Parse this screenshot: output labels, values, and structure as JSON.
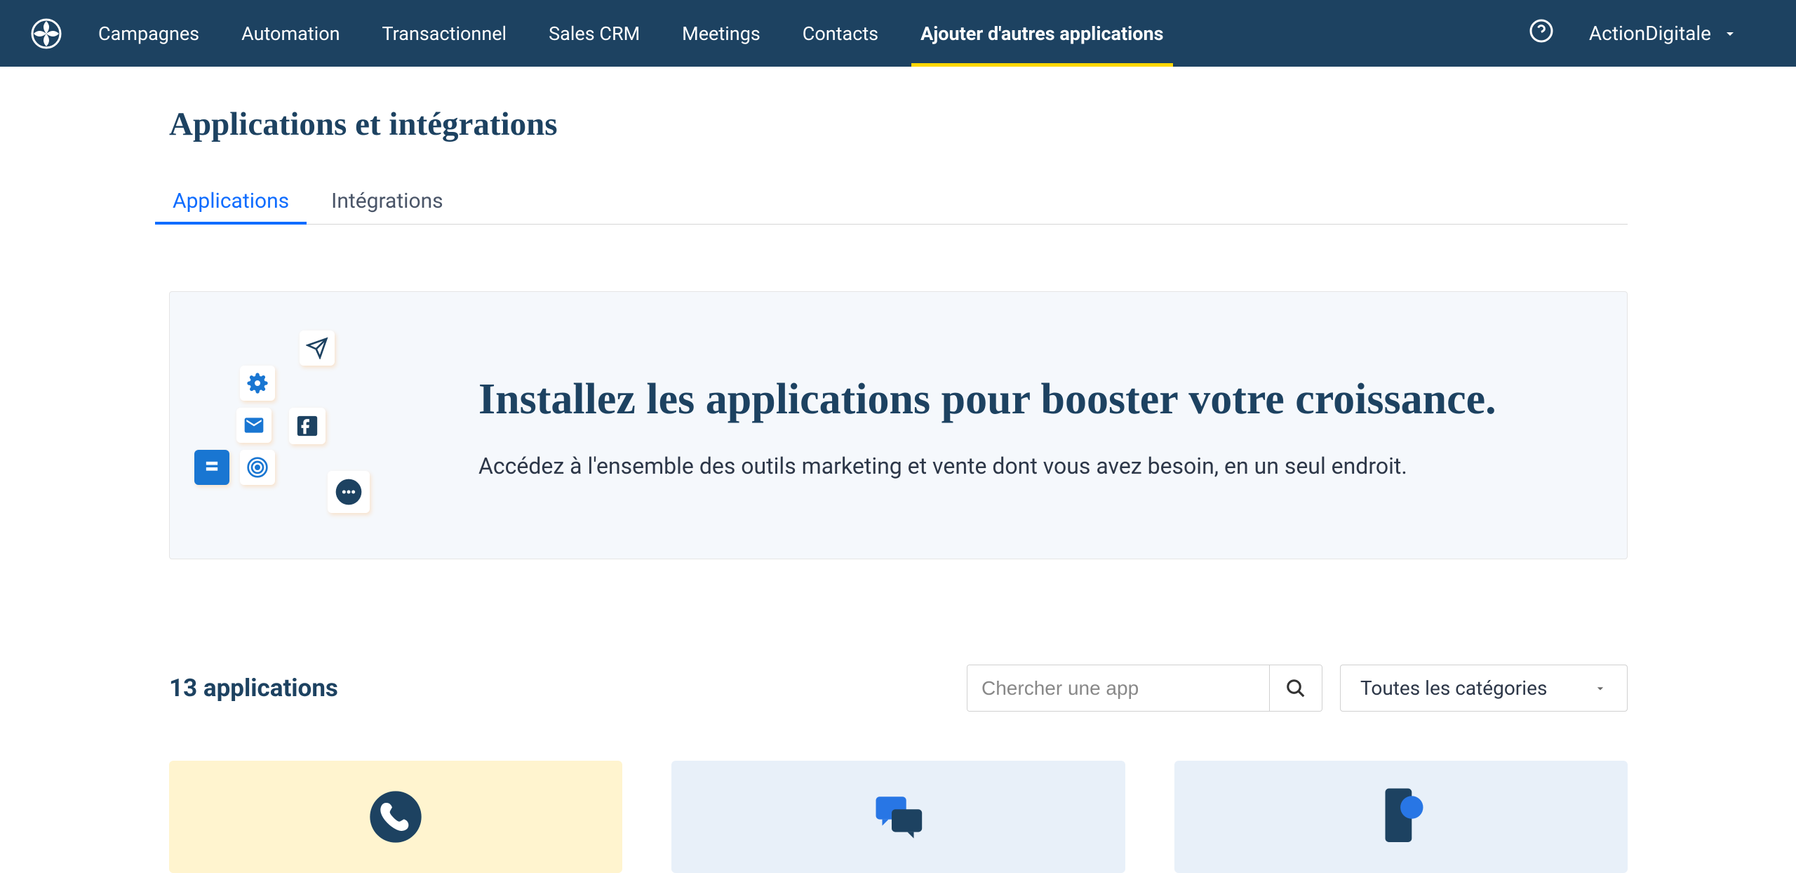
{
  "nav": {
    "items": [
      {
        "label": "Campagnes",
        "active": false
      },
      {
        "label": "Automation",
        "active": false
      },
      {
        "label": "Transactionnel",
        "active": false
      },
      {
        "label": "Sales CRM",
        "active": false
      },
      {
        "label": "Meetings",
        "active": false
      },
      {
        "label": "Contacts",
        "active": false
      },
      {
        "label": "Ajouter d'autres applications",
        "active": true
      }
    ]
  },
  "account": {
    "name": "ActionDigitale"
  },
  "page": {
    "title": "Applications et intégrations"
  },
  "tabs": [
    {
      "label": "Applications",
      "active": true
    },
    {
      "label": "Intégrations",
      "active": false
    }
  ],
  "hero": {
    "title": "Installez les applications pour booster votre croissance.",
    "subtitle": "Accédez à l'ensemble des outils marketing et vente dont vous avez besoin, en un seul endroit."
  },
  "apps": {
    "count_text": "13 applications",
    "search_placeholder": "Chercher une app",
    "category_default": "Toutes les catégories"
  }
}
